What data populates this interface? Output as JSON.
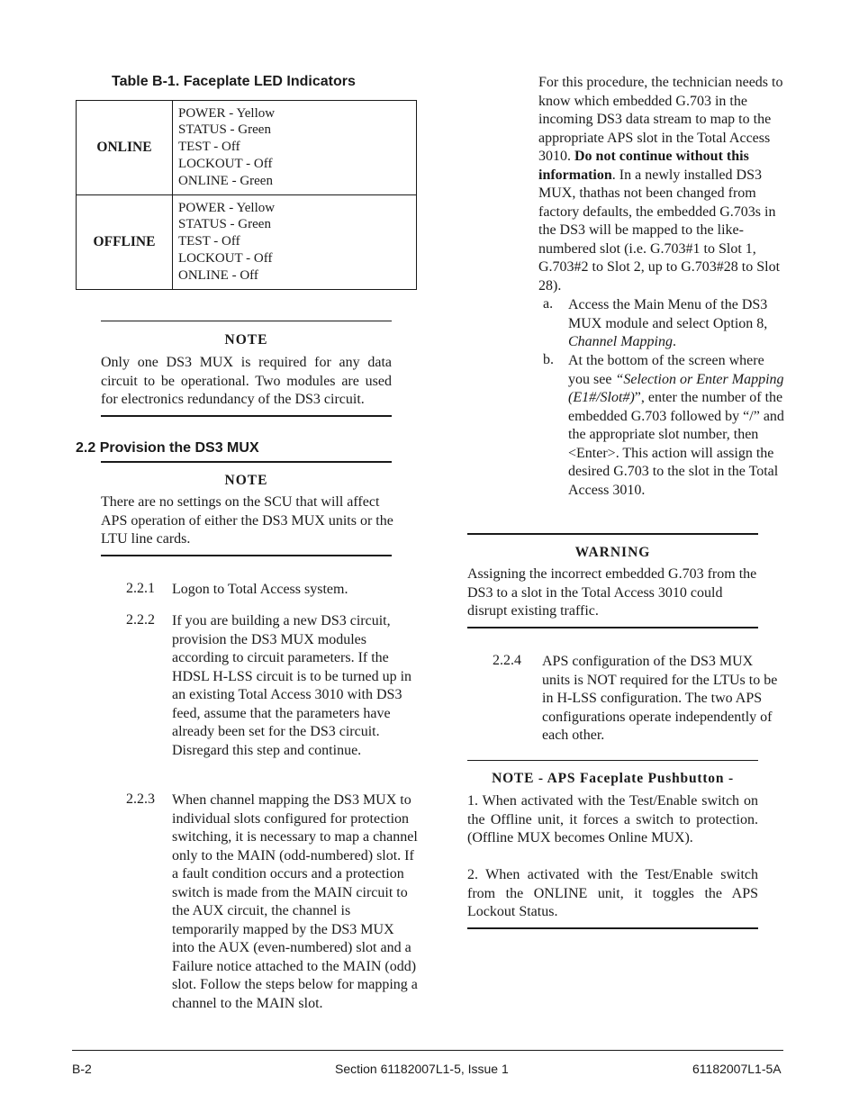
{
  "table": {
    "title": "Table B-1.  Faceplate LED Indicators",
    "rows": [
      {
        "state": "ONLINE",
        "leds": [
          "POWER - Yellow",
          "STATUS - Green",
          "TEST - Off",
          "LOCKOUT - Off",
          "ONLINE - Green"
        ]
      },
      {
        "state": "OFFLINE",
        "leds": [
          "POWER - Yellow",
          "STATUS - Green",
          "TEST - Off",
          "LOCKOUT - Off",
          "ONLINE - Off"
        ]
      }
    ]
  },
  "note1": {
    "heading": "NOTE",
    "text": "Only one DS3 MUX is required for any data circuit to be operational. Two modules are used for electronics redundancy of the DS3 circuit."
  },
  "section": {
    "title": "2.2 Provision the DS3 MUX"
  },
  "note2": {
    "heading": "NOTE",
    "text": "There are no settings on the SCU that will affect APS operation of either the DS3 MUX units or the LTU line cards."
  },
  "steps": [
    {
      "num": "2.2.1",
      "text": "Logon to Total Access system."
    },
    {
      "num": "2.2.2",
      "text": "If you are building a new DS3 circuit, provision the DS3 MUX modules according to circuit parameters.  If the HDSL H-LSS circuit is to be turned up in an existing Total Access 3010 with DS3 feed, assume that the parameters have already been set for the DS3 circuit.  Disregard this step and continue."
    },
    {
      "num": "2.2.3",
      "text": "When channel mapping the DS3 MUX to individual slots configured for protection switching, it is necessary to map a channel only to the MAIN (odd-numbered) slot. If a fault condition occurs and a protection switch is made from the MAIN circuit to the AUX circuit, the channel is temporarily mapped by the DS3 MUX into the AUX (even-numbered) slot and a  Failure notice attached to the MAIN (odd) slot. Follow the steps below for mapping a channel to the MAIN slot."
    }
  ],
  "procedure": {
    "intro_part1": "For this procedure, the technician needs to know which embedded G.703 in the incoming DS3 data stream to map to the appropriate APS slot in the Total Access 3010.  ",
    "intro_bold": "Do not continue without this information",
    "intro_part2": ".  In a newly installed DS3 MUX, thathas not been changed from factory defaults, the embedded G.703s in the DS3 will be mapped to the like-numbered slot (i.e. G.703#1 to Slot 1, G.703#2 to Slot 2, up to G.703#28 to Slot 28).",
    "substeps": [
      {
        "letter": "a.",
        "text_before": "Access the Main Menu of the DS3 MUX module and select Option 8, ",
        "italic": "Channel Mapping",
        "text_after": "."
      },
      {
        "letter": "b.",
        "text_before": "At the bottom of the screen where you see ",
        "italic": "“Selection or Enter Mapping (E1#/Slot#)",
        "text_after": "”, enter the number of the embedded G.703 followed by “/” and the appropriate slot number, then <Enter>.  This action will assign the desired G.703 to the slot in the Total Access 3010."
      }
    ]
  },
  "warning": {
    "heading": "WARNING",
    "text": "Assigning the incorrect embedded G.703 from the DS3 to a slot in the Total Access 3010 could disrupt existing traffic."
  },
  "step224": {
    "num": "2.2.4",
    "text": "APS configuration of the DS3 MUX units is NOT required for the LTUs to be in H-LSS configuration. The two APS configurations operate independently of each other."
  },
  "note3": {
    "heading": "NOTE - APS Faceplate Pushbutton -",
    "item1": "1. When activated with the Test/Enable switch on the Offline unit, it forces a switch to protection. (Offline MUX becomes Online MUX).",
    "item2": "2. When activated with the Test/Enable switch from the ONLINE unit, it toggles the APS Lockout Status."
  },
  "footer": {
    "left": "B-2",
    "center": "Section 61182007L1-5, Issue 1",
    "right": "61182007L1-5A"
  }
}
